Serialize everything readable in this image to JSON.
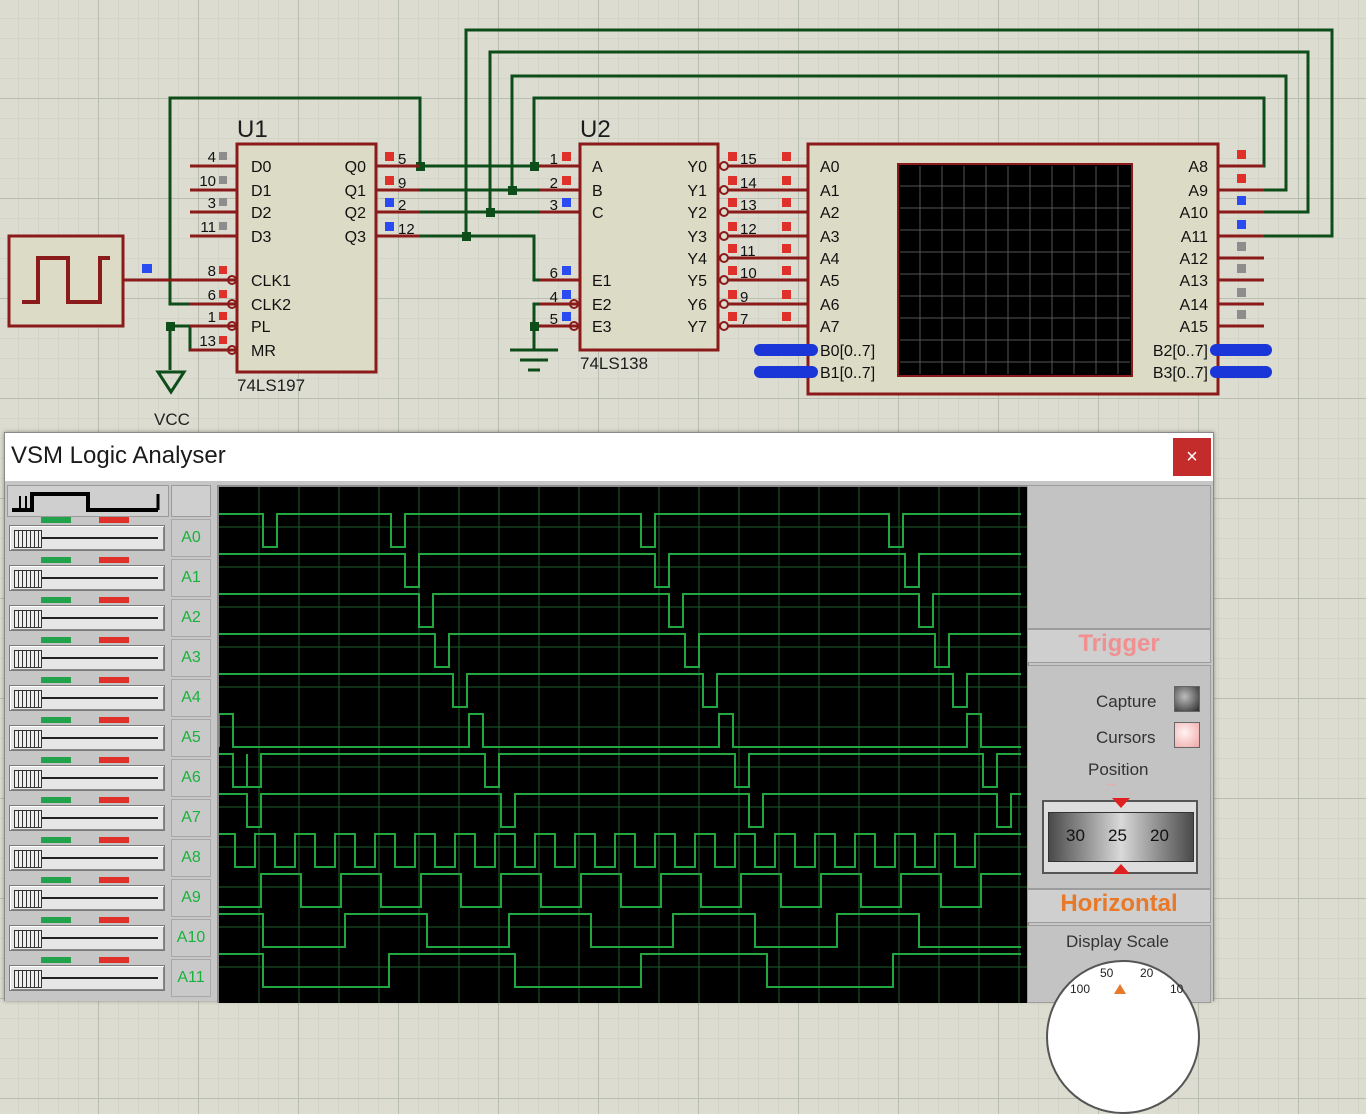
{
  "schematic": {
    "u1": {
      "ref": "U1",
      "part": "74LS197",
      "left_pins": [
        {
          "num": "4",
          "name": "D0"
        },
        {
          "num": "10",
          "name": "D1"
        },
        {
          "num": "3",
          "name": "D2"
        },
        {
          "num": "11",
          "name": "D3"
        },
        {
          "num": "8",
          "name": "CLK1"
        },
        {
          "num": "6",
          "name": "CLK2"
        },
        {
          "num": "1",
          "name": "PL"
        },
        {
          "num": "13",
          "name": "MR"
        }
      ],
      "right_pins": [
        {
          "num": "5",
          "name": "Q0"
        },
        {
          "num": "9",
          "name": "Q1"
        },
        {
          "num": "2",
          "name": "Q2"
        },
        {
          "num": "12",
          "name": "Q3"
        }
      ]
    },
    "u2": {
      "ref": "U2",
      "part": "74LS138",
      "left_pins": [
        {
          "num": "1",
          "name": "A"
        },
        {
          "num": "2",
          "name": "B"
        },
        {
          "num": "3",
          "name": "C"
        },
        {
          "num": "6",
          "name": "E1"
        },
        {
          "num": "4",
          "name": "E2"
        },
        {
          "num": "5",
          "name": "E3"
        }
      ],
      "right_pins": [
        {
          "num": "15",
          "name": "Y0"
        },
        {
          "num": "14",
          "name": "Y1"
        },
        {
          "num": "13",
          "name": "Y2"
        },
        {
          "num": "12",
          "name": "Y3"
        },
        {
          "num": "11",
          "name": "Y4"
        },
        {
          "num": "10",
          "name": "Y5"
        },
        {
          "num": "9",
          "name": "Y6"
        },
        {
          "num": "7",
          "name": "Y7"
        }
      ]
    },
    "analyser_block": {
      "left_pins": [
        "A0",
        "A1",
        "A2",
        "A3",
        "A4",
        "A5",
        "A6",
        "A7",
        "B0[0..7]",
        "B1[0..7]"
      ],
      "right_pins": [
        "A8",
        "A9",
        "A10",
        "A11",
        "A12",
        "A13",
        "A14",
        "A15",
        "B2[0..7]",
        "B3[0..7]"
      ]
    },
    "vcc_label": "VCC"
  },
  "window": {
    "title": "VSM Logic Analyser",
    "close_label": "×"
  },
  "channels": [
    "A0",
    "A1",
    "A2",
    "A3",
    "A4",
    "A5",
    "A6",
    "A7",
    "A8",
    "A9",
    "A10",
    "A11"
  ],
  "panel": {
    "trigger_heading": "Trigger",
    "capture_label": "Capture",
    "cursors_label": "Cursors",
    "position_label": "Position",
    "position_scale": [
      "30",
      "25",
      "20"
    ],
    "horizontal_heading": "Horizontal",
    "display_scale_label": "Display Scale",
    "display_scale_ticks": [
      "100",
      "50",
      "20",
      "10"
    ]
  },
  "colors": {
    "wire": "#0d4d1a",
    "ic_fill": "#dcdcc6",
    "ic_border": "#8b1a1a",
    "trace": "#22a640",
    "trigger_heading": "#f09090",
    "horizontal_heading": "#e8792a",
    "channel_label": "#17b23c"
  }
}
